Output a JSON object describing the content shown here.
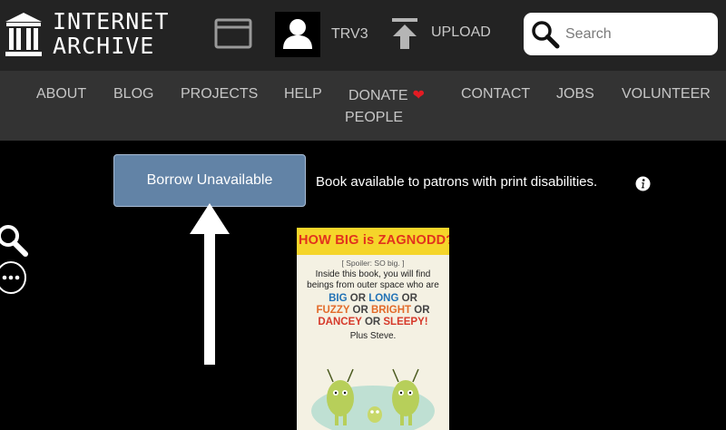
{
  "header": {
    "logo_line1": "INTERNET",
    "logo_line2": "ARCHIVE",
    "username": "TRV3",
    "upload_label": "UPLOAD",
    "search_placeholder": "Search"
  },
  "nav": {
    "about": "ABOUT",
    "blog": "BLOG",
    "projects": "PROJECTS",
    "help": "HELP",
    "donate": "DONATE",
    "contact": "CONTACT",
    "jobs": "JOBS",
    "volunteer": "VOLUNTEER",
    "people": "PEOPLE"
  },
  "main": {
    "borrow_button": "Borrow Unavailable",
    "availability_text": "Book available to patrons with print disabilities."
  },
  "cover": {
    "title": "HOW BIG is ZAGNODD?",
    "spoiler": "[ Spoiler: SO big. ]",
    "line1": "Inside this book, you will find",
    "line2": "beings from outer space who are",
    "w_big": "BIG",
    "w_or1": "OR",
    "w_long": "LONG",
    "w_or2": "OR",
    "w_fuzzy": "FUZZY",
    "w_or3": "OR",
    "w_bright": "BRIGHT",
    "w_or4": "OR",
    "w_dancey": "DANCEY",
    "w_or5": "OR",
    "w_sleepy": "SLEEPY!",
    "plus": "Plus Steve."
  },
  "colors": {
    "topbar": "#232323",
    "navbar": "#333333",
    "button": "#6283a6",
    "heart": "#e41b23",
    "cover_title_bg": "#f5d52a",
    "cover_title_text": "#e2321d"
  }
}
